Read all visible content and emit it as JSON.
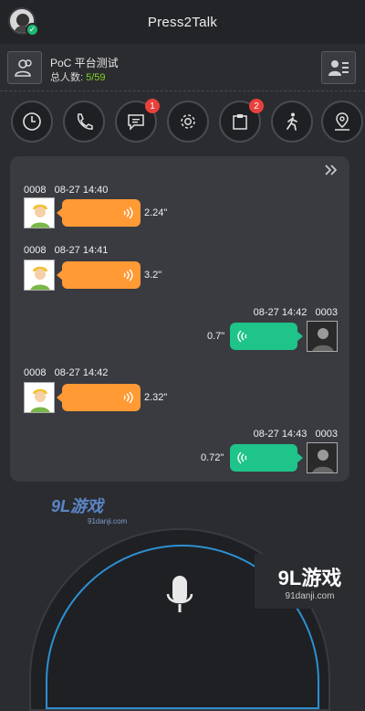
{
  "header": {
    "title": "Press2Talk"
  },
  "group": {
    "name": "PoC 平台测试",
    "members_label": "总人数: ",
    "members_value": "5/59"
  },
  "toolbar": {
    "items": [
      {
        "icon": "clock-icon",
        "badge": ""
      },
      {
        "icon": "phone-icon",
        "badge": ""
      },
      {
        "icon": "message-icon",
        "badge": "1"
      },
      {
        "icon": "gear-icon",
        "badge": ""
      },
      {
        "icon": "clipboard-icon",
        "badge": "2"
      },
      {
        "icon": "walking-person-icon",
        "badge": ""
      },
      {
        "icon": "location-pin-icon",
        "badge": ""
      }
    ]
  },
  "messages": [
    {
      "user": "0008",
      "time": "08-27 14:40",
      "duration": "2.24\"",
      "side": "left"
    },
    {
      "user": "0008",
      "time": "08-27 14:41",
      "duration": "3.2\"",
      "side": "left"
    },
    {
      "user": "0003",
      "time": "08-27 14:42",
      "duration": "0.7\"",
      "side": "right"
    },
    {
      "user": "0008",
      "time": "08-27 14:42",
      "duration": "2.32\"",
      "side": "left"
    },
    {
      "user": "0003",
      "time": "08-27 14:43",
      "duration": "0.72\"",
      "side": "right"
    }
  ],
  "watermark": {
    "small_logo": "9L游戏",
    "small_url": "91danji.com",
    "big_logo": "9L游戏",
    "big_url": "91danji.com"
  },
  "colors": {
    "background": "#2b2c30",
    "accent_green": "#1ec48a",
    "accent_orange": "#ff9a35",
    "badge_red": "#e8413b",
    "ptt_ring": "#2e8fd1"
  }
}
